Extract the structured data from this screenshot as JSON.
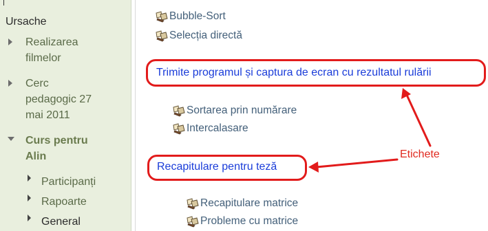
{
  "sidebar": {
    "top_item": "Ursache",
    "realizarea": [
      "Realizarea",
      "filmelor"
    ],
    "cerc": [
      "Cerc",
      "pedagogic 27",
      "mai 2011"
    ],
    "curs": [
      "Curs pentru",
      "Alin"
    ],
    "subitems": [
      "Participanți",
      "Rapoarte",
      "General"
    ]
  },
  "resources_top": [
    "Bubble-Sort",
    "Selecția directă"
  ],
  "label1": "Trimite programul și captura de ecran cu rezultatul rulării",
  "resources_mid": [
    "Sortarea prin numărare",
    "Intercalasare"
  ],
  "label2": "Recapitulare pentru teză",
  "resources_bottom": [
    "Recapitulare matrice",
    "Probleme cu matrice"
  ],
  "annotation": "Etichete",
  "colors": {
    "sidebar_bg": "#e9efde",
    "link_blue": "#1a3cd9",
    "highlight_red": "#e21b1b"
  }
}
